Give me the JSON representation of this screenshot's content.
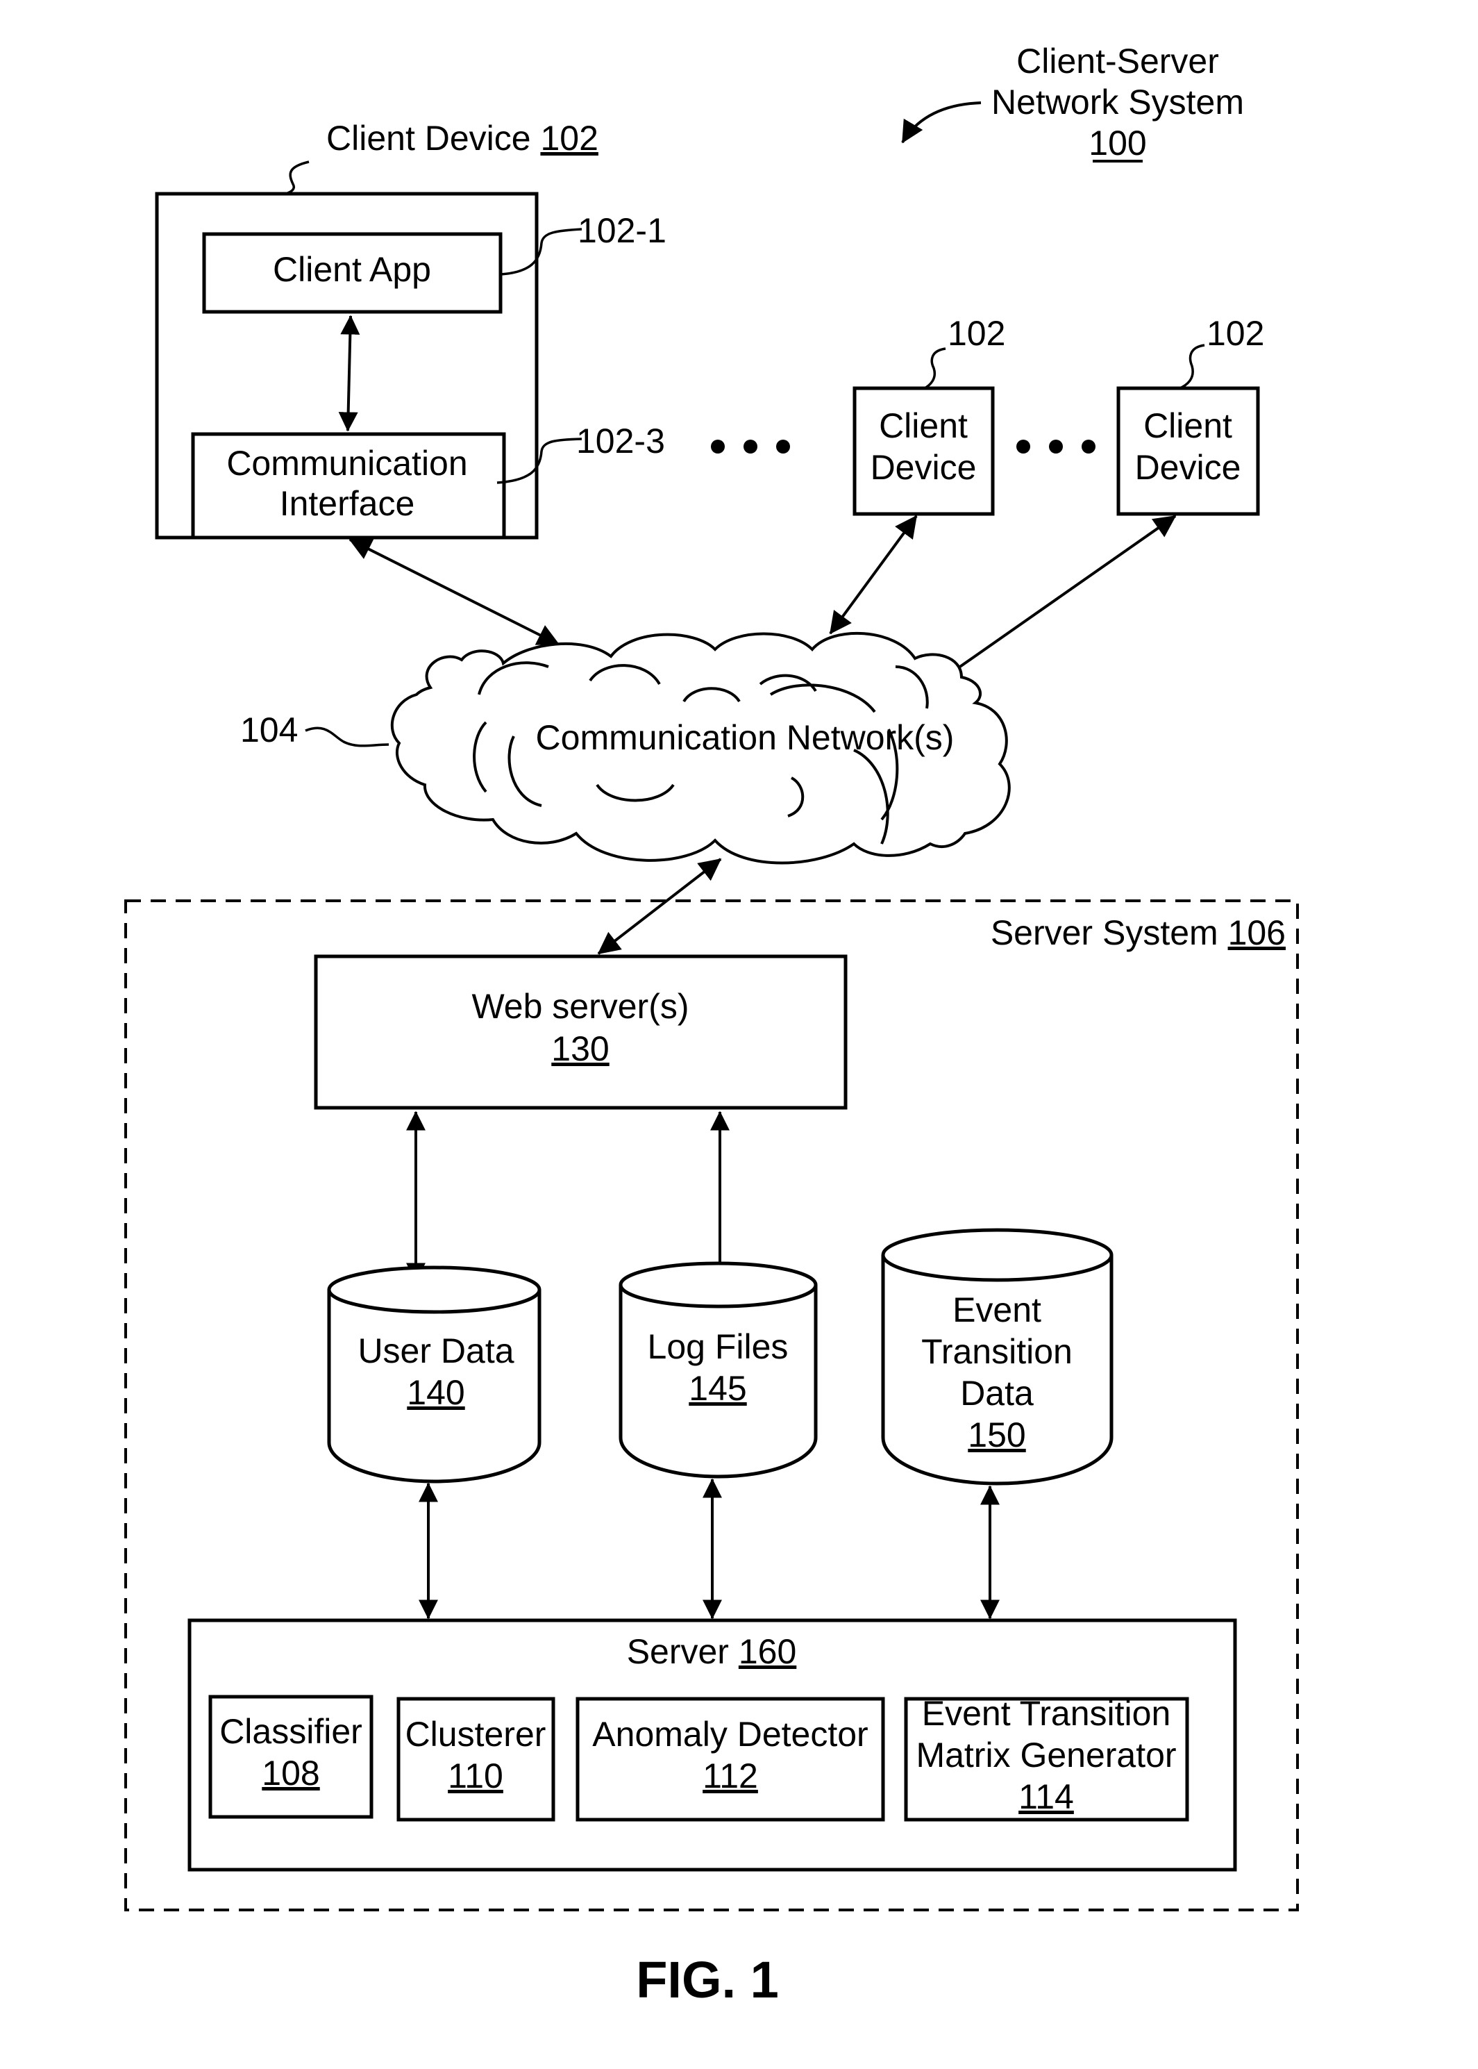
{
  "figure": {
    "title": "Client-Server Network System 100",
    "caption": "FIG. 1"
  },
  "system_label": {
    "line1": "Client-Server",
    "line2": "Network System",
    "ref": "100"
  },
  "client_device_main": {
    "label": "Client Device ",
    "ref": "102",
    "client_app": {
      "label": "Client App",
      "ref": "102-1"
    },
    "comm_interface": {
      "line1": "Communication",
      "line2": "Interface",
      "ref": "102-3"
    }
  },
  "client_devices": [
    {
      "line1": "Client",
      "line2": "Device",
      "ref": "102"
    },
    {
      "line1": "Client",
      "line2": "Device",
      "ref": "102"
    }
  ],
  "ellipsis": "• • •",
  "network": {
    "label": "Communication Network(s)",
    "ref": "104"
  },
  "server_system": {
    "label": "Server System ",
    "ref": "106",
    "web_server": {
      "label": "Web server(s)",
      "ref": "130"
    },
    "datastores": [
      {
        "lines": [
          "User Data"
        ],
        "ref": "140"
      },
      {
        "lines": [
          "Log Files"
        ],
        "ref": "145"
      },
      {
        "lines": [
          "Event",
          "Transition",
          "Data"
        ],
        "ref": "150"
      }
    ],
    "server": {
      "label": "Server ",
      "ref": "160",
      "modules": [
        {
          "lines": [
            "Classifier"
          ],
          "ref": "108"
        },
        {
          "lines": [
            "Clusterer"
          ],
          "ref": "110"
        },
        {
          "lines": [
            "Anomaly Detector"
          ],
          "ref": "112"
        },
        {
          "lines": [
            "Event Transition",
            "Matrix Generator"
          ],
          "ref": "114"
        }
      ]
    }
  }
}
